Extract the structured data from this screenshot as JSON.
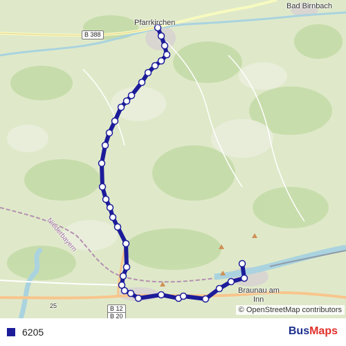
{
  "map": {
    "places": {
      "pfarrkirchen": "Pfarrkirchen",
      "bad_birnbach": "Bad Birnbach",
      "braunau_line1": "Braunau am",
      "braunau_line2": "Inn",
      "niederbayern": "Niederbayern"
    },
    "roads": {
      "b388": "B 388",
      "b12": "B 12",
      "b20": "B 20",
      "r25": "25"
    },
    "route_color": "#1c1c9a",
    "attribution": "© OpenStreetMap contributors"
  },
  "legend": {
    "route_name": "6205",
    "swatch_color": "#1c1c9a"
  },
  "brand": {
    "part1": "Bus",
    "part2": "Maps"
  }
}
